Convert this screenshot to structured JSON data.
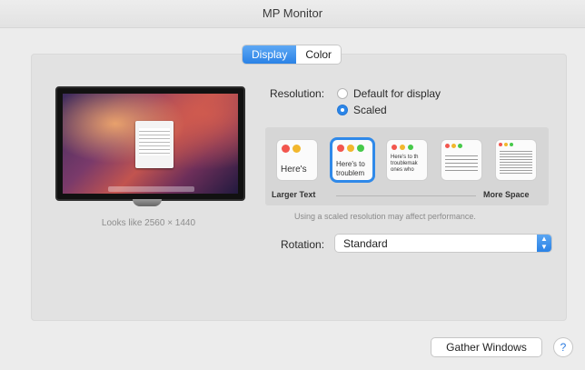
{
  "window": {
    "title": "MP Monitor"
  },
  "tabs": [
    {
      "label": "Display",
      "active": true
    },
    {
      "label": "Color",
      "active": false
    }
  ],
  "display": {
    "looks_like": "Looks like 2560 × 1440",
    "resolution": {
      "label": "Resolution:",
      "options": [
        {
          "label": "Default for display",
          "selected": false
        },
        {
          "label": "Scaled",
          "selected": true
        }
      ]
    },
    "scale": {
      "left_label": "Larger Text",
      "right_label": "More Space",
      "hint": "Using a scaled resolution may affect performance.",
      "thumbs": [
        {
          "text": "Here's",
          "selected": false
        },
        {
          "text": "Here's to",
          "text2": "troublem",
          "selected": true
        },
        {
          "text": "Here's to th",
          "text2": "troublemak",
          "text3": "ones who",
          "selected": false
        },
        {
          "text": "",
          "selected": false
        },
        {
          "text": "",
          "selected": false
        }
      ]
    },
    "rotation": {
      "label": "Rotation:",
      "value": "Standard"
    }
  },
  "footer": {
    "gather_label": "Gather Windows",
    "help_label": "?"
  },
  "colors": {
    "accent": "#2c86e8",
    "red": "#f2564e",
    "yellow": "#f2b72d",
    "green": "#46c94a"
  }
}
